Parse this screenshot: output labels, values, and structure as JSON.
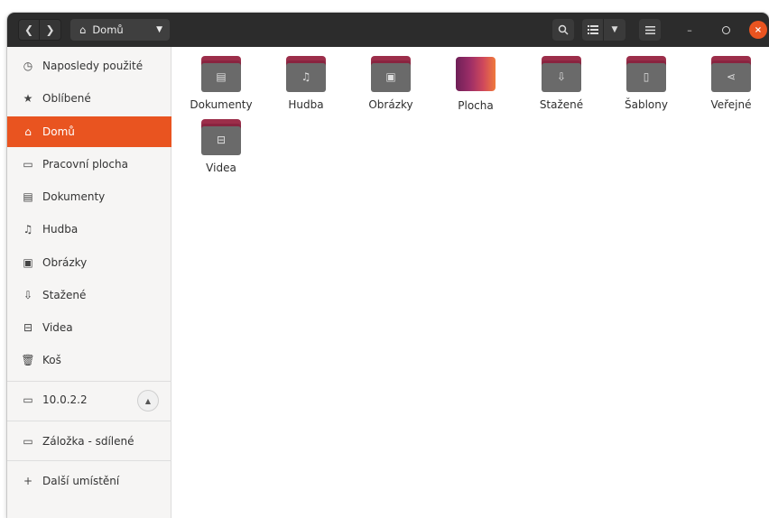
{
  "headerbar": {
    "back_icon": "chevron-left-icon",
    "forward_icon": "chevron-right-icon",
    "path_label": "Domů",
    "path_icon": "home-icon",
    "search_icon": "search-icon",
    "view_icon": "list-view-icon",
    "view_menu_icon": "caret-down-icon",
    "menu_icon": "hamburger-menu-icon",
    "window_controls": {
      "minimize": "–",
      "maximize": "▫",
      "close": "×"
    }
  },
  "sidebar": {
    "items": [
      {
        "label": "Naposledy použité",
        "icon": "clock-icon"
      },
      {
        "label": "Oblíbené",
        "icon": "star-icon"
      },
      {
        "label": "Domů",
        "icon": "home-icon",
        "active": true
      },
      {
        "label": "Pracovní plocha",
        "icon": "desktop-icon"
      },
      {
        "label": "Dokumenty",
        "icon": "document-icon"
      },
      {
        "label": "Hudba",
        "icon": "music-icon"
      },
      {
        "label": "Obrázky",
        "icon": "image-icon"
      },
      {
        "label": "Stažené",
        "icon": "download-icon"
      },
      {
        "label": "Videa",
        "icon": "video-icon"
      },
      {
        "label": "Koš",
        "icon": "trash-icon"
      }
    ],
    "network": {
      "label": "10.0.2.2",
      "icon": "network-drive-icon",
      "eject_icon": "eject-icon"
    },
    "bookmark": {
      "label": "Záložka - sdílené",
      "icon": "folder-icon"
    },
    "other": {
      "label": "Další umístění",
      "icon": "plus-icon"
    }
  },
  "content": {
    "items": [
      {
        "label": "Dokumenty",
        "icon": "document-icon"
      },
      {
        "label": "Hudba",
        "icon": "music-icon"
      },
      {
        "label": "Obrázky",
        "icon": "image-icon"
      },
      {
        "label": "Plocha",
        "icon": "desktop-icon"
      },
      {
        "label": "Stažené",
        "icon": "download-icon"
      },
      {
        "label": "Šablony",
        "icon": "template-icon"
      },
      {
        "label": "Veřejné",
        "icon": "share-icon"
      },
      {
        "label": "Videa",
        "icon": "video-icon"
      }
    ]
  },
  "colors": {
    "accent": "#e95420",
    "headerbar": "#2c2c2c",
    "folder_tab": "#9c2e4a",
    "folder_body": "#6a6a6a"
  }
}
